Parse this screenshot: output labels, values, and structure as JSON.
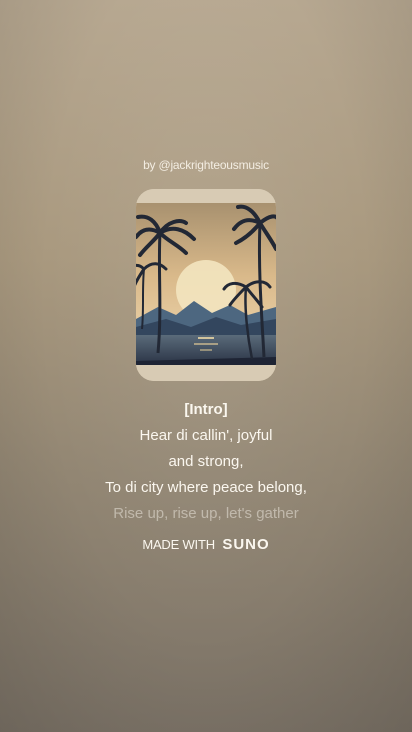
{
  "artist_credit": "by @jackrighteousmusic",
  "lyrics": {
    "section": "[Intro]",
    "lines": [
      "Hear di callin', joyful",
      "and strong,",
      "To di city where peace belong,",
      "Rise up, rise up, let's gather"
    ]
  },
  "footer": {
    "made_with": "MADE WITH",
    "brand": "SUNO"
  },
  "cover_art": {
    "description_icon": "sunset-palm-artwork"
  }
}
